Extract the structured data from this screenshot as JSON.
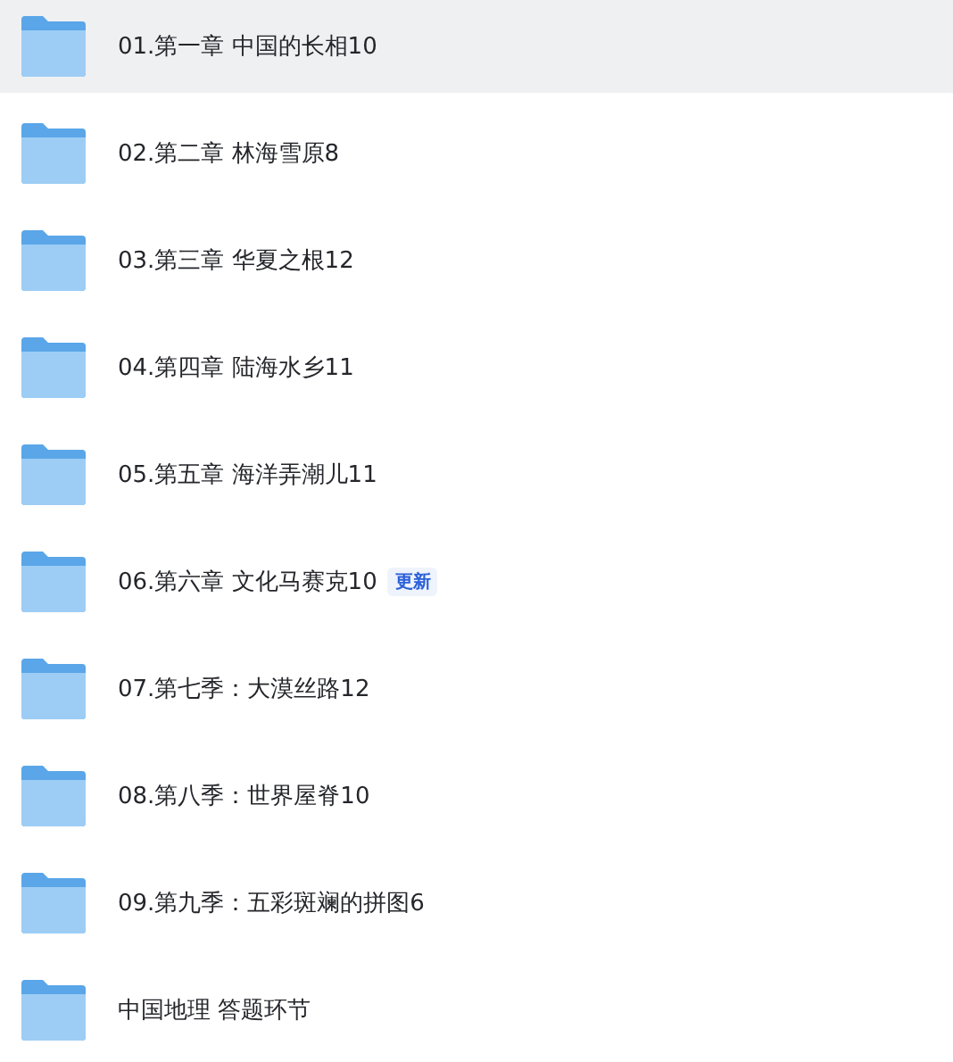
{
  "folders": [
    {
      "name": "01.第一章 中国的长相10",
      "selected": true
    },
    {
      "name": "02.第二章 林海雪原8",
      "selected": false
    },
    {
      "name": "03.第三章 华夏之根12",
      "selected": false
    },
    {
      "name": "04.第四章 陆海水乡11",
      "selected": false
    },
    {
      "name": "05.第五章 海洋弄潮儿11",
      "selected": false
    },
    {
      "name": "06.第六章 文化马赛克10",
      "selected": false,
      "badge": "更新"
    },
    {
      "name": "07.第七季：大漠丝路12",
      "selected": false
    },
    {
      "name": "08.第八季：世界屋脊10",
      "selected": false
    },
    {
      "name": "09.第九季：五彩斑斓的拼图6",
      "selected": false
    },
    {
      "name": "中国地理 答题环节",
      "selected": false
    }
  ]
}
